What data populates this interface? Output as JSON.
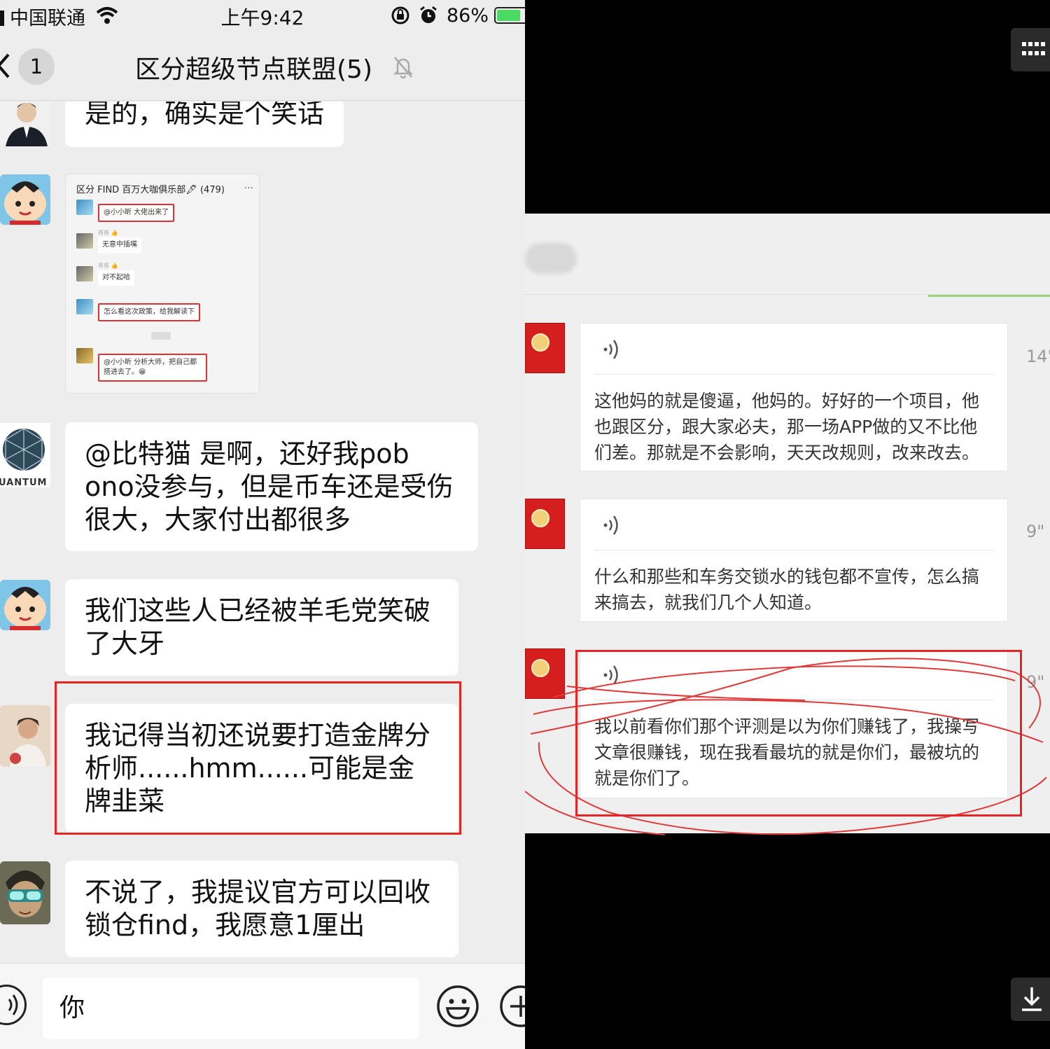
{
  "status_bar": {
    "carrier": "中国联通",
    "time": "上午9:42",
    "battery": "86%",
    "battery_level": 0.86
  },
  "nav": {
    "unread_count": "1",
    "title": "区分超级节点联盟(5)"
  },
  "messages": [
    {
      "text": "是的，确实是个笑话"
    },
    {
      "type": "image"
    },
    {
      "text": "@比特猫 是啊，还好我pob ono没参与，但是币车还是受伤很大，大家付出都很多",
      "avatar_label": "UANTUM"
    },
    {
      "text": "我们这些人已经被羊毛党笑破了大牙"
    },
    {
      "text": "我记得当初还说要打造金牌分析师......hmm......可能是金牌韭菜",
      "highlighted": true
    },
    {
      "text": "不说了，我提议官方可以回收锁仓find，我愿意1厘出"
    }
  ],
  "shared_screenshot": {
    "title": "区分 FIND 百万大咖俱乐部🖋 (479)",
    "more": "...",
    "messages": [
      {
        "text": "@小小昕 大佬出来了",
        "highlighted": true
      },
      {
        "text": "无意中插嘴",
        "highlighted": false
      },
      {
        "text": "对不起哈",
        "highlighted": false
      },
      {
        "text": "怎么看这次政策，给我解读下",
        "highlighted": true
      },
      {
        "text": "@小小昕 分析大师，把自己都搭进去了。😁",
        "highlighted": true
      }
    ]
  },
  "input": {
    "value": "你"
  },
  "icons": {
    "voice": "voice-icon",
    "emoji": "emoji-icon",
    "plus": "plus-icon",
    "grid": "grid-icon",
    "download": "download-icon"
  },
  "voice_messages": [
    {
      "duration": "14\"",
      "text": "这他妈的就是傻逼，他妈的。好好的一个项目，他也跟区分，跟大家必夫，那一场APP做的又不比他们差。那就是不会影响，天天改规则，改来改去。"
    },
    {
      "duration": "9\"",
      "text": "什么和那些和车务交锁水的钱包都不宣传，怎么搞来搞去，就我们几个人知道。"
    },
    {
      "duration": "9\"",
      "text": "我以前看你们那个评测是以为你们赚钱了，我操写文章很赚钱，现在我看最坑的就是你们，最被坑的就是你们了。",
      "highlighted": true
    }
  ],
  "colors": {
    "highlight": "#e52525",
    "bubble": "#ffffff",
    "chat_bg": "#ededed",
    "battery": "#4cd964",
    "red_packet": "#d51f1f"
  }
}
